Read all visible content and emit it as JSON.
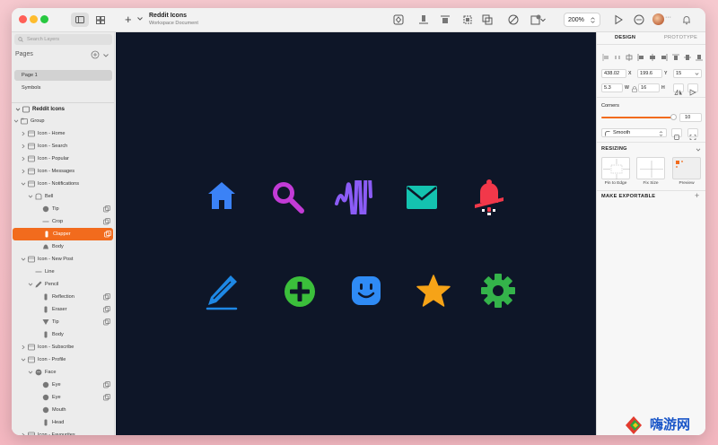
{
  "titlebar": {
    "doc_title": "Reddit Icons",
    "doc_subtitle": "Workspace Document",
    "insert_label": "+",
    "zoom": "200%",
    "avatar_more": "···"
  },
  "layers_panel": {
    "search_placeholder": "Search Layers",
    "pages_header": "Pages",
    "pages": [
      {
        "label": "Page 1",
        "selected": true
      },
      {
        "label": "Symbols",
        "selected": false
      }
    ],
    "document_name": "Reddit Icons",
    "layers": [
      {
        "label": "Group",
        "icon": "group-icon"
      },
      {
        "label": "Icon - Home",
        "icon": "symbol-icon"
      },
      {
        "label": "Icon - Search",
        "icon": "symbol-icon"
      },
      {
        "label": "Icon - Popular",
        "icon": "symbol-icon"
      },
      {
        "label": "Icon - Messages",
        "icon": "symbol-icon"
      },
      {
        "label": "Icon - Notifications",
        "icon": "symbol-icon"
      },
      {
        "label": "Bell",
        "icon": "shape-group-icon"
      },
      {
        "label": "Tip",
        "icon": "oval-icon"
      },
      {
        "label": "Crop",
        "icon": "line-icon"
      },
      {
        "label": "Clapper",
        "icon": "rect-icon"
      },
      {
        "label": "Body",
        "icon": "bell-shape-icon"
      },
      {
        "label": "Icon - New Post",
        "icon": "symbol-icon"
      },
      {
        "label": "Line",
        "icon": "line-icon"
      },
      {
        "label": "Pencil",
        "icon": "pencil-shape-icon"
      },
      {
        "label": "Reflection",
        "icon": "rect-icon"
      },
      {
        "label": "Eraser",
        "icon": "rect-icon"
      },
      {
        "label": "Tip",
        "icon": "triangle-icon"
      },
      {
        "label": "Body",
        "icon": "rect-icon"
      },
      {
        "label": "Icon - Subscribe",
        "icon": "symbol-icon"
      },
      {
        "label": "Icon - Profile",
        "icon": "symbol-icon"
      },
      {
        "label": "Face",
        "icon": "face-shape-icon"
      },
      {
        "label": "Eye",
        "icon": "oval-icon"
      },
      {
        "label": "Eye",
        "icon": "oval-icon"
      },
      {
        "label": "Mouth",
        "icon": "oval-icon"
      },
      {
        "label": "Head",
        "icon": "rect-icon"
      },
      {
        "label": "Icon - Favourites",
        "icon": "symbol-icon"
      }
    ]
  },
  "canvas": {
    "background": "#0e1628",
    "icons": [
      {
        "name": "home-icon",
        "color": "#3b82f6"
      },
      {
        "name": "search-icon",
        "color": "#c23bd6"
      },
      {
        "name": "popular-wave-icon",
        "color": "#8b5cf6"
      },
      {
        "name": "messages-envelope-icon",
        "color": "#14c3b0"
      },
      {
        "name": "notifications-bell-icon",
        "color": "#f2384a"
      },
      {
        "name": "new-post-pencil-icon",
        "color": "#1e88e5"
      },
      {
        "name": "subscribe-plus-icon",
        "color": "#3bbf3b"
      },
      {
        "name": "profile-face-icon",
        "color": "#2f8bf5"
      },
      {
        "name": "favourites-star-icon",
        "color": "#f6a317"
      },
      {
        "name": "settings-gear-icon",
        "color": "#34b34a"
      }
    ]
  },
  "inspector": {
    "tab_design": "DESIGN",
    "tab_prototype": "PROTOTYPE",
    "x_value": "438.02",
    "x_label": "X",
    "y_value": "199.6",
    "y_label": "Y",
    "rotation_value": "15",
    "w_value": "5.3",
    "w_label": "W",
    "h_value": "16",
    "h_label": "H",
    "corners_label": "Corners",
    "corner_radius": "10",
    "corner_style": "Smooth",
    "resizing_label": "RESIZING",
    "pin_to_edge": "Pin to Edge",
    "fix_size": "Fix Size",
    "preview": "Preview",
    "make_exportable": "MAKE EXPORTABLE",
    "accent": "#f26b1d"
  },
  "watermark": {
    "text": "嗨游网"
  }
}
